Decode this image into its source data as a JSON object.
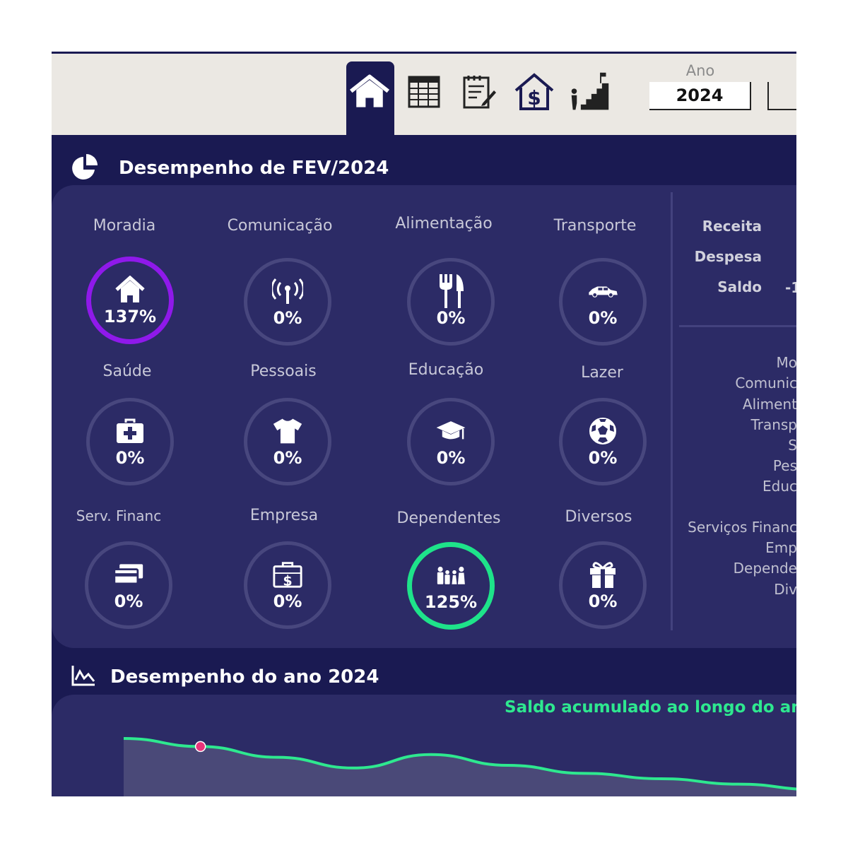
{
  "toolbar": {
    "year_label": "Ano",
    "year_value": "2024",
    "nav_icons": [
      "home-icon",
      "table-icon",
      "notes-icon",
      "house-dollar-icon",
      "stairs-goal-icon"
    ]
  },
  "monthly": {
    "title": "Desempenho de FEV/2024",
    "categories": [
      {
        "label": "Moradia",
        "pct": "137%",
        "icon": "house-icon"
      },
      {
        "label": "Comunicação",
        "pct": "0%",
        "icon": "antenna-icon"
      },
      {
        "label": "Alimentação",
        "pct": "0%",
        "icon": "fork-knife-icon"
      },
      {
        "label": "Transporte",
        "pct": "0%",
        "icon": "car-icon"
      },
      {
        "label": "Saúde",
        "pct": "0%",
        "icon": "first-aid-icon"
      },
      {
        "label": "Pessoais",
        "pct": "0%",
        "icon": "tshirt-icon"
      },
      {
        "label": "Educação",
        "pct": "0%",
        "icon": "graduation-cap-icon"
      },
      {
        "label": "Lazer",
        "pct": "0%",
        "icon": "soccer-ball-icon"
      },
      {
        "label": "Serv. Financ",
        "pct": "0%",
        "icon": "credit-cards-icon"
      },
      {
        "label": "Empresa",
        "pct": "0%",
        "icon": "briefcase-dollar-icon"
      },
      {
        "label": "Dependentes",
        "pct": "125%",
        "icon": "family-icon"
      },
      {
        "label": "Diversos",
        "pct": "0%",
        "icon": "gift-icon"
      }
    ],
    "summary": {
      "receita_label": "Receita",
      "despesa_label": "Despesa",
      "saldo_label": "Saldo",
      "saldo_value": "-1"
    },
    "category_list": [
      "Mo",
      "Comunic",
      "Aliment",
      "Transp",
      "S",
      "Pes",
      "Educ",
      "Serviços Financ",
      "Emp",
      "Depende",
      "Div"
    ]
  },
  "yearly": {
    "title": "Desempenho do ano 2024",
    "chart_title": "Saldo acumulado ao longo do ano"
  },
  "colors": {
    "background": "#1a1a52",
    "panel": "#2c2b66",
    "ring_default": "#48477e",
    "ring_over_purple": "#8f19ea",
    "ring_over_green": "#1ee38a",
    "line": "#2ee88f",
    "marker": "#e8337a"
  },
  "chart_data": {
    "type": "area",
    "title": "Saldo acumulado ao longo do ano",
    "x": [
      1,
      2,
      3,
      4,
      5,
      6,
      7,
      8,
      9,
      10
    ],
    "values": [
      0,
      -3,
      -7,
      -11,
      -6,
      -10,
      -13,
      -15,
      -17,
      -19
    ],
    "highlight_index": 1,
    "grid": false,
    "legend": "none"
  }
}
